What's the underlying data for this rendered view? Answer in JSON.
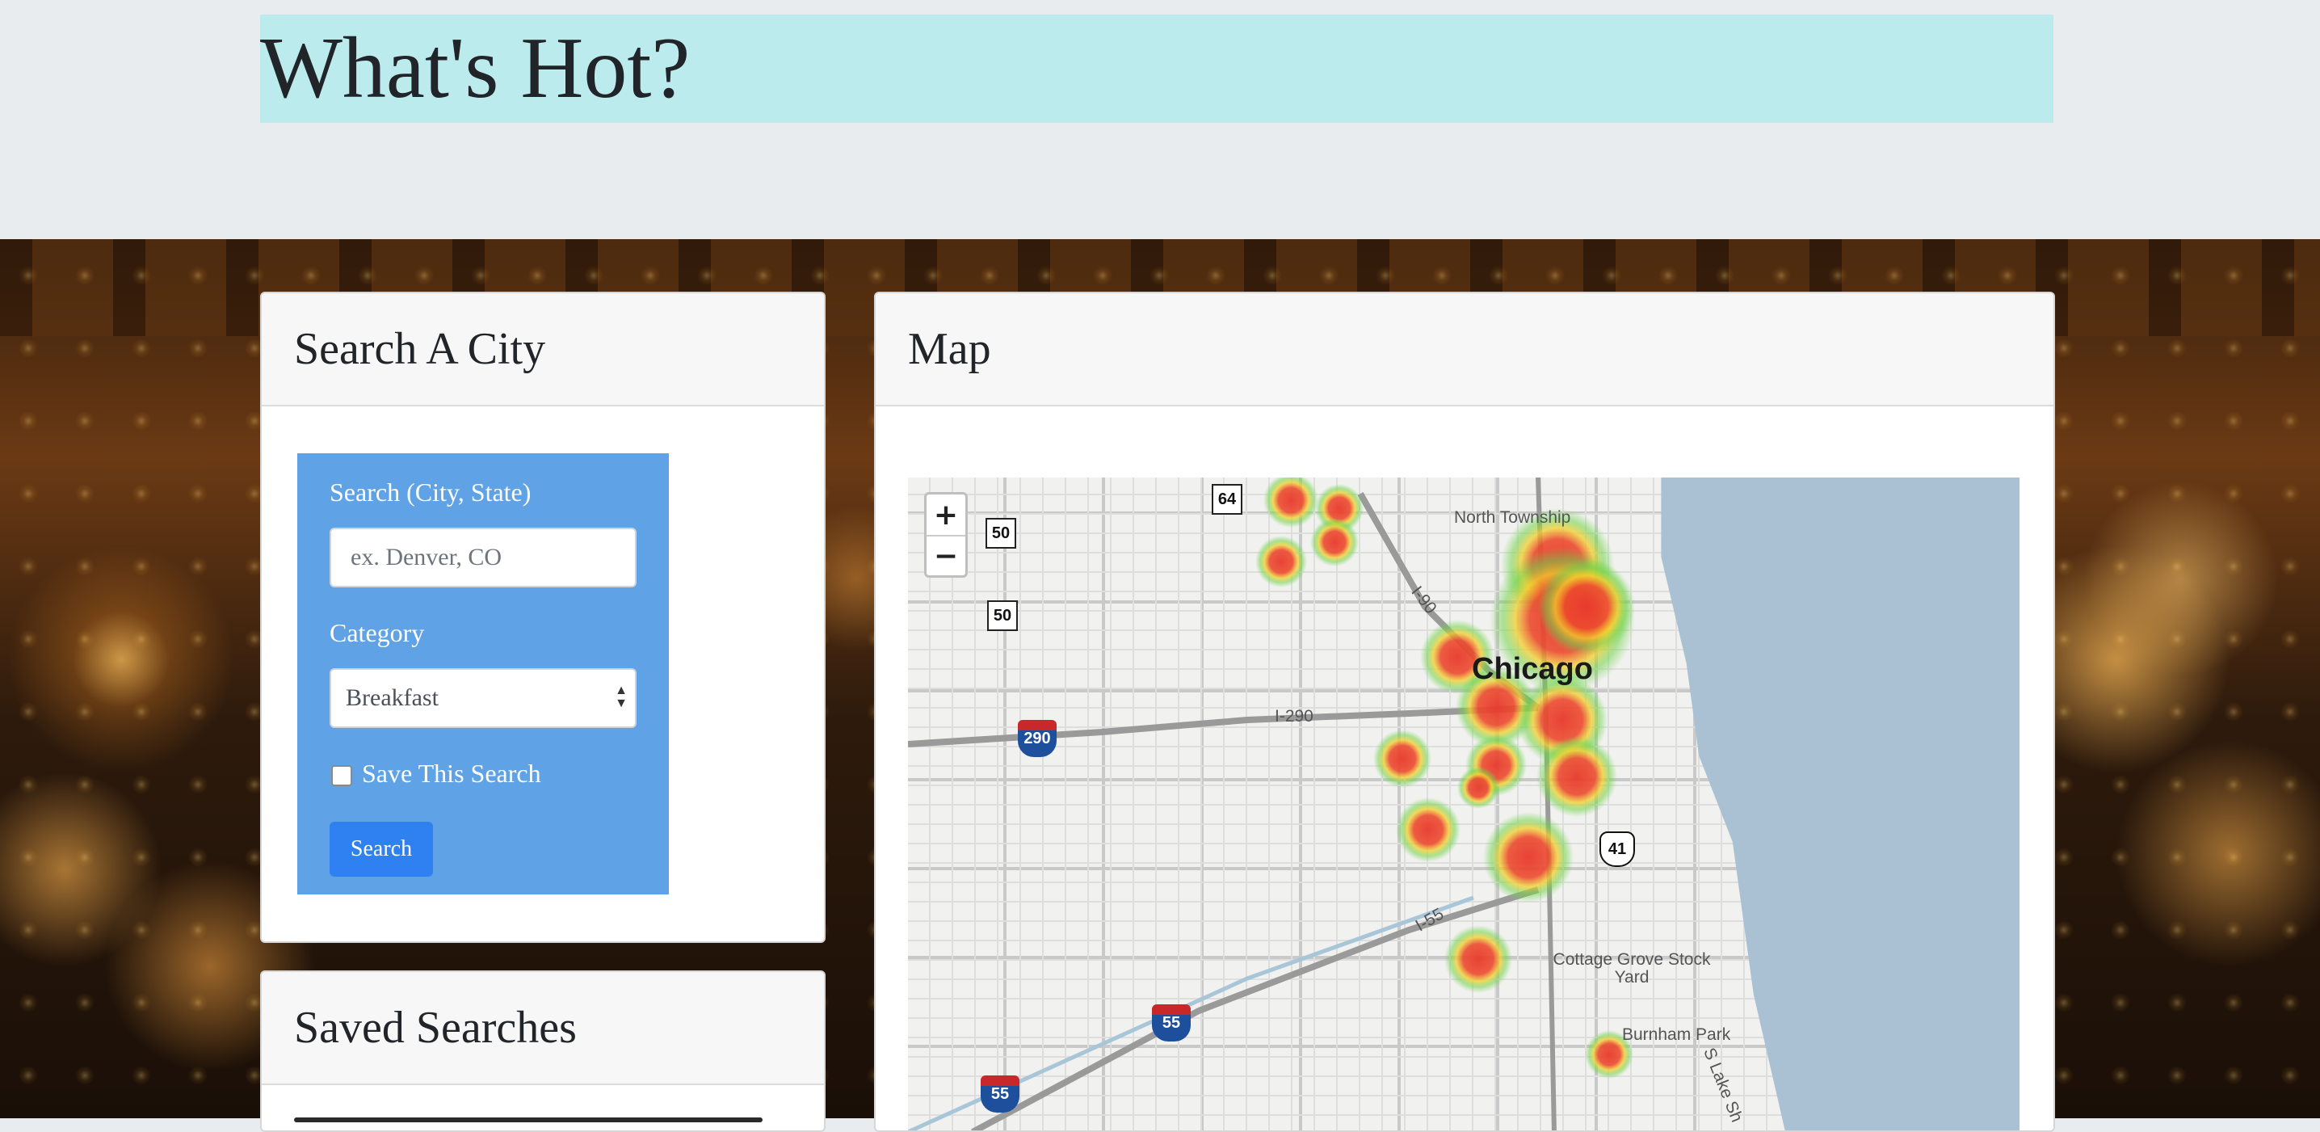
{
  "header": {
    "title": "What's Hot?"
  },
  "search_card": {
    "title": "Search A City",
    "search_label": "Search (City, State)",
    "search_placeholder": "ex. Denver, CO",
    "search_value": "",
    "category_label": "Category",
    "category_selected": "Breakfast",
    "save_label": "Save This Search",
    "save_checked": false,
    "search_button": "Search"
  },
  "saved_card": {
    "title": "Saved Searches"
  },
  "map_card": {
    "title": "Map",
    "zoom_in": "+",
    "zoom_out": "−",
    "labels": {
      "city": "Chicago",
      "north_township": "North Township",
      "i90": "I-90",
      "i290": "I-290",
      "i55": "I-55",
      "cottage_grove": "Cottage Grove Stock Yard",
      "burnham_park": "Burnham Park",
      "lake_shore": "S Lake Sh"
    },
    "shields": {
      "us64": "64",
      "us50_a": "50",
      "us50_b": "50",
      "i290": "290",
      "us41": "41",
      "i55_a": "55",
      "i55_b": "55"
    }
  },
  "colors": {
    "title_bg": "#bcebed",
    "form_panel": "#5fa2e6",
    "button": "#2f80f0",
    "heat_hot": "#e8392c",
    "heat_mid": "#f2d02a",
    "heat_cool": "#6fd34a"
  }
}
